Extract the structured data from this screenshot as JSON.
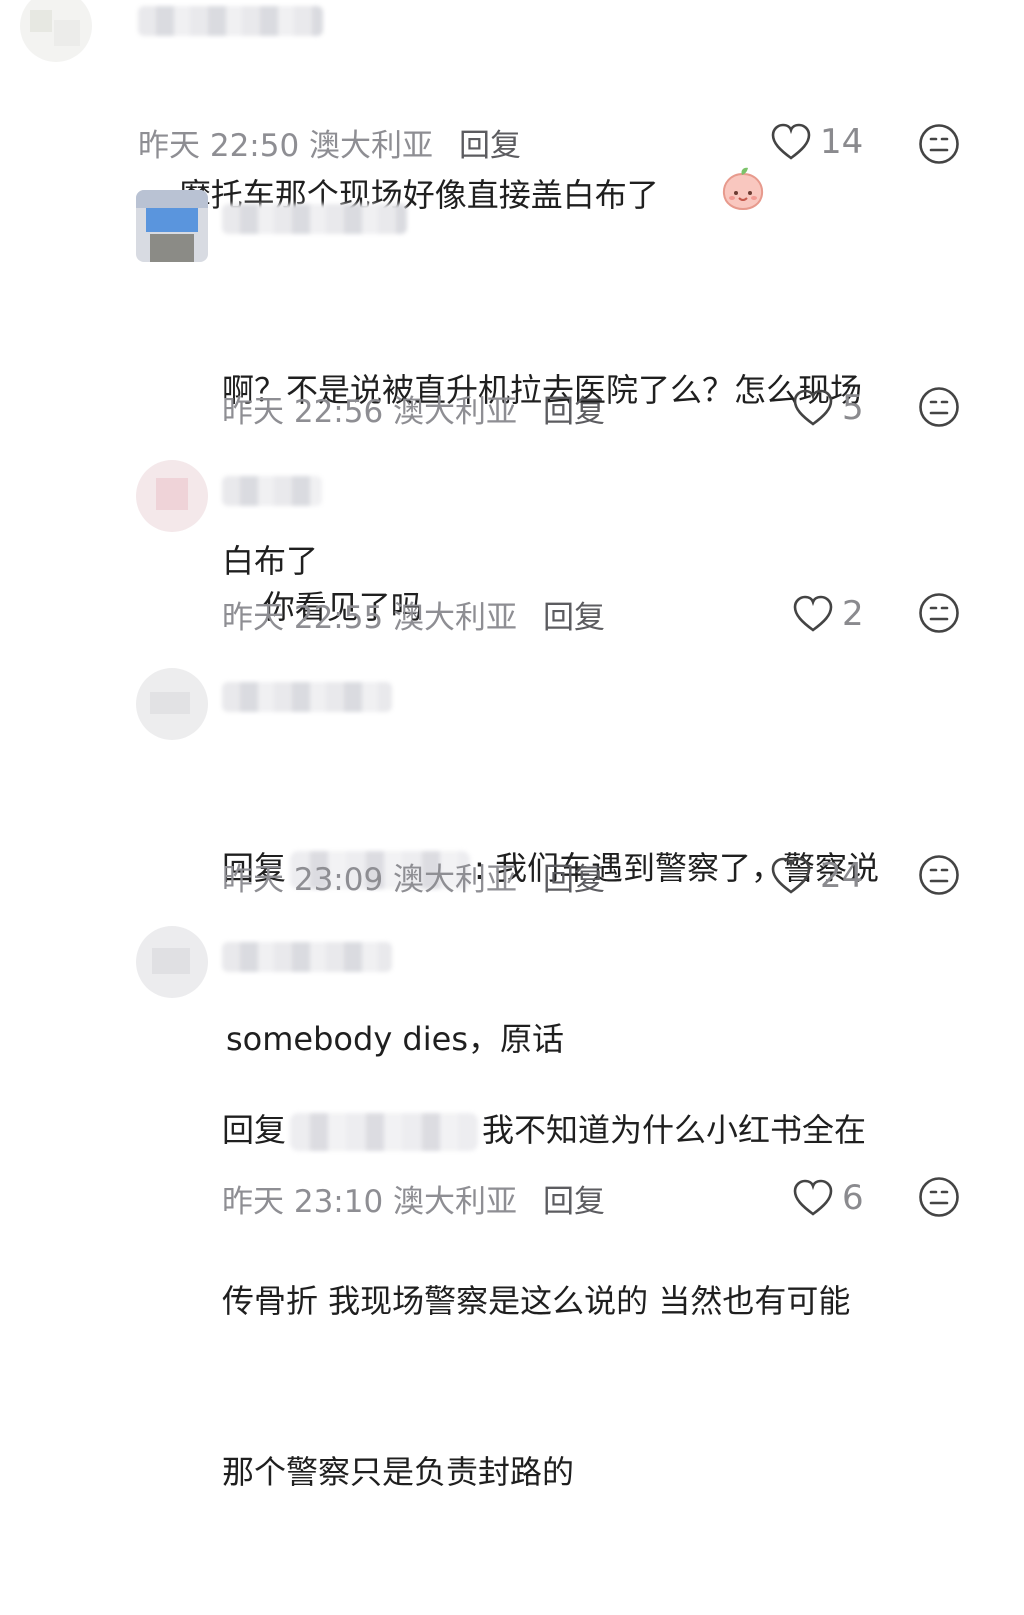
{
  "comments": [
    {
      "text": "摩托车那个现场好像直接盖白布了",
      "time": "昨天 22:50 澳大利亚",
      "reply": "回复",
      "likes": "14"
    },
    {
      "text_lines": [
        "啊？不是说被直升机拉去医院了么？怎么现场",
        "白布了"
      ],
      "time": "昨天 22:56 澳大利亚",
      "reply": "回复",
      "likes": "5"
    },
    {
      "text": "你看见了吗",
      "time": "昨天 22:55 澳大利亚",
      "reply": "回复",
      "likes": "2"
    },
    {
      "prefix": "回复",
      "text_line1": ": 我们车遇到警察了，警察说",
      "text_line2": "somebody dies，原话",
      "time": "昨天 23:09 澳大利亚",
      "reply": "回复",
      "likes": "24"
    },
    {
      "prefix": "回复",
      "text_line1": "我不知道为什么小红书全在",
      "text_line2": "传骨折 我现场警察是这么说的 当然也有可能",
      "text_line3": "那个警察只是负责封路的",
      "time": "昨天 23:10 澳大利亚",
      "reply": "回复",
      "likes": "6"
    }
  ],
  "icons": {
    "like": "heart-outline-icon",
    "react": "neutral-face-icon",
    "emoji": "peach-face-emoji"
  }
}
